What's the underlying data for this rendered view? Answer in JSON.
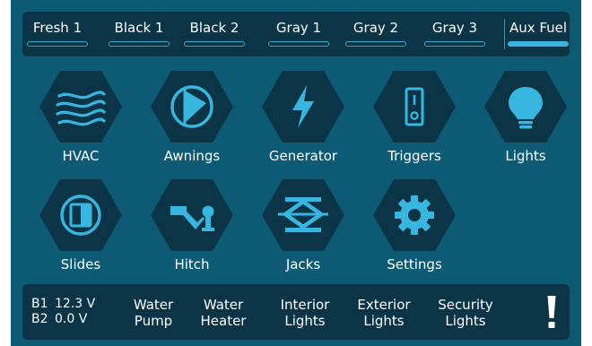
{
  "tanks": [
    {
      "label": "Fresh 1",
      "level": 0,
      "active": false
    },
    {
      "label": "Black 1",
      "level": 0,
      "active": false
    },
    {
      "label": "Black 2",
      "level": 0,
      "active": false
    },
    {
      "label": "Gray 1",
      "level": 0,
      "active": false
    },
    {
      "label": "Gray 2",
      "level": 0,
      "active": false
    },
    {
      "label": "Gray 3",
      "level": 0,
      "active": false
    },
    {
      "label": "Aux Fuel",
      "level": 1,
      "active": true
    }
  ],
  "tiles": [
    {
      "label": "HVAC",
      "icon": "hvac-icon"
    },
    {
      "label": "Awnings",
      "icon": "awning-icon"
    },
    {
      "label": "Generator",
      "icon": "lightning-bolt-icon"
    },
    {
      "label": "Triggers",
      "icon": "toggle-switch-icon"
    },
    {
      "label": "Lights",
      "icon": "light-bulb-icon"
    },
    {
      "label": "Slides",
      "icon": "slide-out-icon"
    },
    {
      "label": "Hitch",
      "icon": "trailer-hitch-icon"
    },
    {
      "label": "Jacks",
      "icon": "scissor-jack-icon"
    },
    {
      "label": "Settings",
      "icon": "gear-icon"
    }
  ],
  "batteries": [
    {
      "name": "B1",
      "voltage": "12.3 V"
    },
    {
      "name": "B2",
      "voltage": "0.0 V"
    }
  ],
  "switches": [
    {
      "line1": "Water",
      "line2": "Pump"
    },
    {
      "line1": "Water",
      "line2": "Heater"
    },
    {
      "line1": "Interior",
      "line2": "Lights"
    },
    {
      "line1": "Exterior",
      "line2": "Lights"
    },
    {
      "line1": "Security",
      "line2": "Lights"
    }
  ],
  "alert": {
    "icon": "exclamation-alert-icon"
  },
  "colors": {
    "background": "#0d5a74",
    "panel": "#0b3447",
    "accent": "#39b6e0",
    "text": "#ffffff"
  }
}
